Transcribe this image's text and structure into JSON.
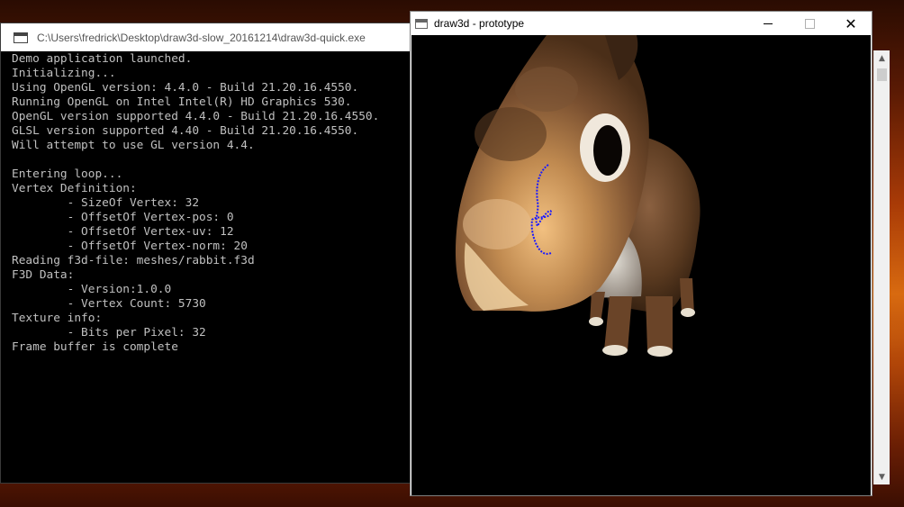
{
  "console": {
    "title": "C:\\Users\\fredrick\\Desktop\\draw3d-slow_20161214\\draw3d-quick.exe",
    "lines": [
      "Demo application launched.",
      "Initializing...",
      "Using OpenGL version: 4.4.0 - Build 21.20.16.4550.",
      "Running OpenGL on Intel Intel(R) HD Graphics 530.",
      "OpenGL version supported 4.4.0 - Build 21.20.16.4550.",
      "GLSL version supported 4.40 - Build 21.20.16.4550.",
      "Will attempt to use GL version 4.4.",
      "",
      "Entering loop...",
      "Vertex Definition:",
      "        - SizeOf Vertex: 32",
      "        - OffsetOf Vertex-pos: 0",
      "        - OffsetOf Vertex-uv: 12",
      "        - OffsetOf Vertex-norm: 20",
      "Reading f3d-file: meshes/rabbit.f3d",
      "F3D Data:",
      "        - Version:1.0.0",
      "        - Vertex Count: 5730",
      "Texture info:",
      "        - Bits per Pixel: 32",
      "Frame buffer is complete"
    ]
  },
  "proto": {
    "title": "draw3d - prototype",
    "minimize_label": "",
    "maximize_label": "",
    "close_label": "✕"
  },
  "bg_scrollbar": {
    "up": "▲",
    "down": "▼"
  },
  "colors": {
    "console_bg": "#000000",
    "console_text": "#c0c0c0",
    "stroke": "#1a1aff"
  }
}
